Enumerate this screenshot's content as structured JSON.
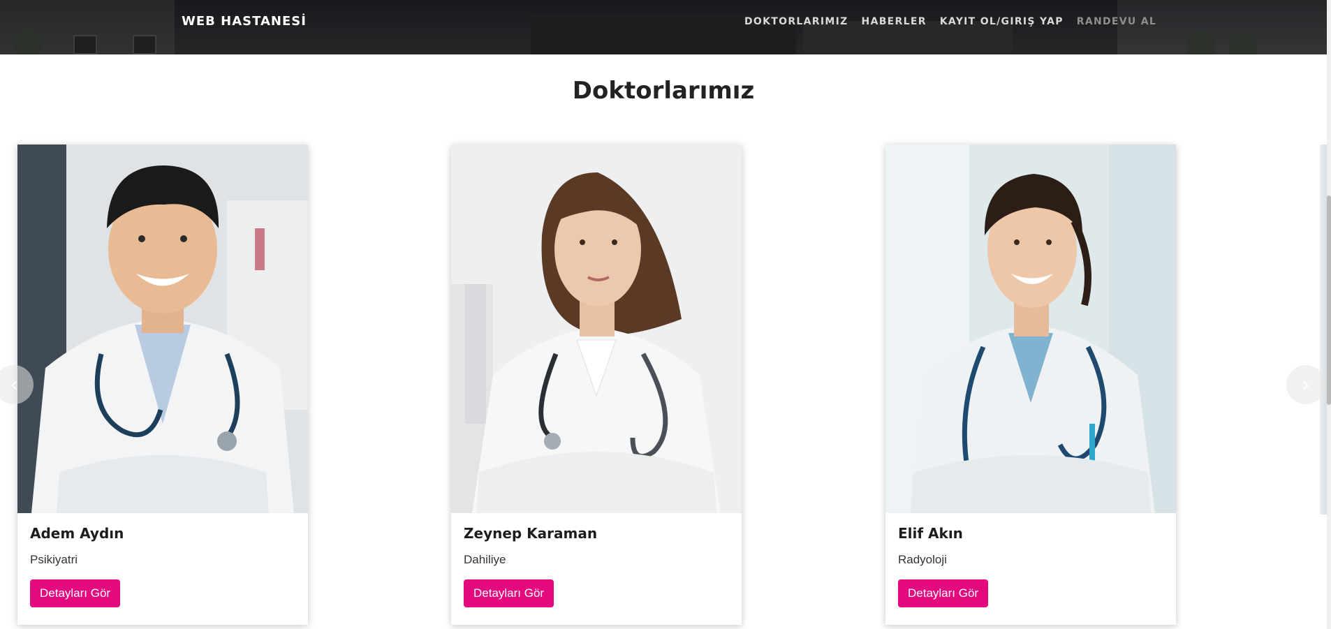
{
  "header": {
    "brand": "WEB HASTANESİ",
    "nav": [
      {
        "label": "DOKTORLARIMIZ"
      },
      {
        "label": "HABERLER"
      },
      {
        "label": "KAYIT OL/GIRIŞ YAP"
      },
      {
        "label": "RANDEVU AL"
      }
    ]
  },
  "section": {
    "title": "Doktorlarımız"
  },
  "doctors": [
    {
      "name": "Adem Aydın",
      "department": "Psikiyatri",
      "button": "Detayları Gör"
    },
    {
      "name": "Zeynep Karaman",
      "department": "Dahiliye",
      "button": "Detayları Gör"
    },
    {
      "name": "Elif Akın",
      "department": "Radyoloji",
      "button": "Detayları Gör"
    }
  ],
  "carousel": {
    "prev_icon": "chevron-left-icon",
    "next_icon": "chevron-right-icon"
  },
  "colors": {
    "accent": "#e5097f",
    "header_bg": "#2f3235",
    "coat": "#eef1f3",
    "stethoscope": "#1e3f5c"
  }
}
